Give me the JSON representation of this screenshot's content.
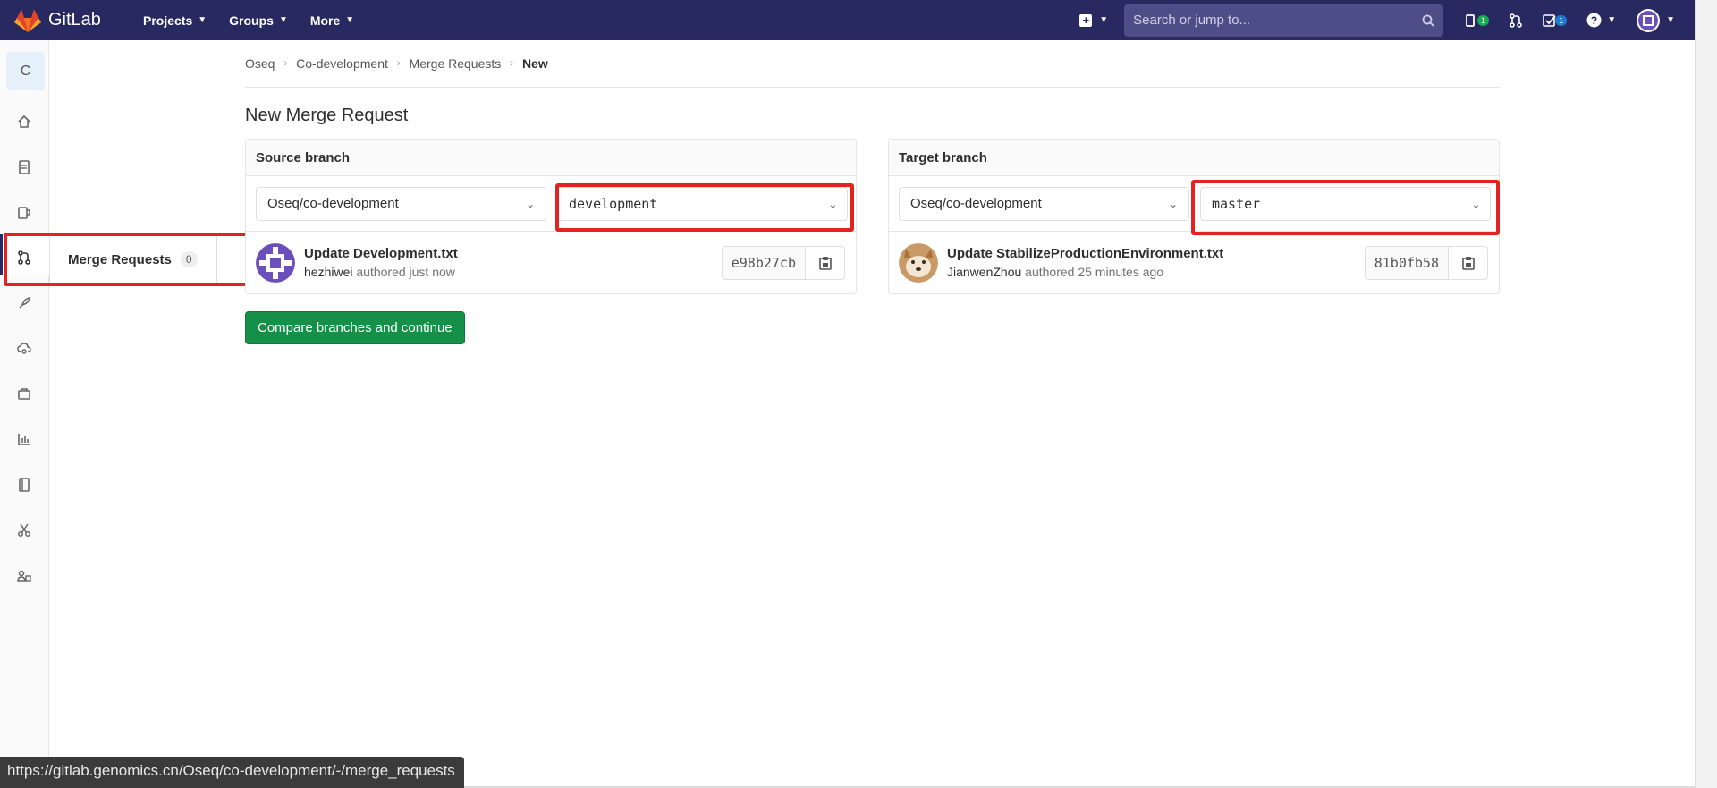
{
  "topbar": {
    "brand": "GitLab",
    "nav": [
      {
        "label": "Projects"
      },
      {
        "label": "Groups"
      },
      {
        "label": "More"
      }
    ],
    "search_placeholder": "Search or jump to...",
    "issues_badge": "1",
    "todos_badge": "1",
    "colors": {
      "bg": "#292961",
      "search_bg": "#4d4d87"
    }
  },
  "sidebar": {
    "project_letter": "C",
    "icons": [
      "home-icon",
      "repository-icon",
      "issues-icon",
      "merge-requests-icon",
      "ci-cd-icon",
      "operations-icon",
      "packages-icon",
      "analytics-icon",
      "wiki-icon",
      "snippets-icon",
      "members-icon"
    ]
  },
  "flyout": {
    "label": "Merge Requests",
    "count": "0"
  },
  "breadcrumb": {
    "items": [
      "Oseq",
      "Co-development",
      "Merge Requests"
    ],
    "current": "New"
  },
  "page": {
    "title": "New Merge Request",
    "compare_button": "Compare branches and continue"
  },
  "source": {
    "heading": "Source branch",
    "project": "Oseq/co-development",
    "branch": "development",
    "commit_message": "Update Development.txt",
    "author": "hezhiwei",
    "authored": "authored just now",
    "sha": "e98b27cb"
  },
  "target": {
    "heading": "Target branch",
    "project": "Oseq/co-development",
    "branch": "master",
    "commit_message": "Update StabilizeProductionEnvironment.txt",
    "author": "JianwenZhou",
    "authored": "authored 25 minutes ago",
    "sha": "81b0fb58"
  },
  "status_url": "https://gitlab.genomics.cn/Oseq/co-development/-/merge_requests"
}
